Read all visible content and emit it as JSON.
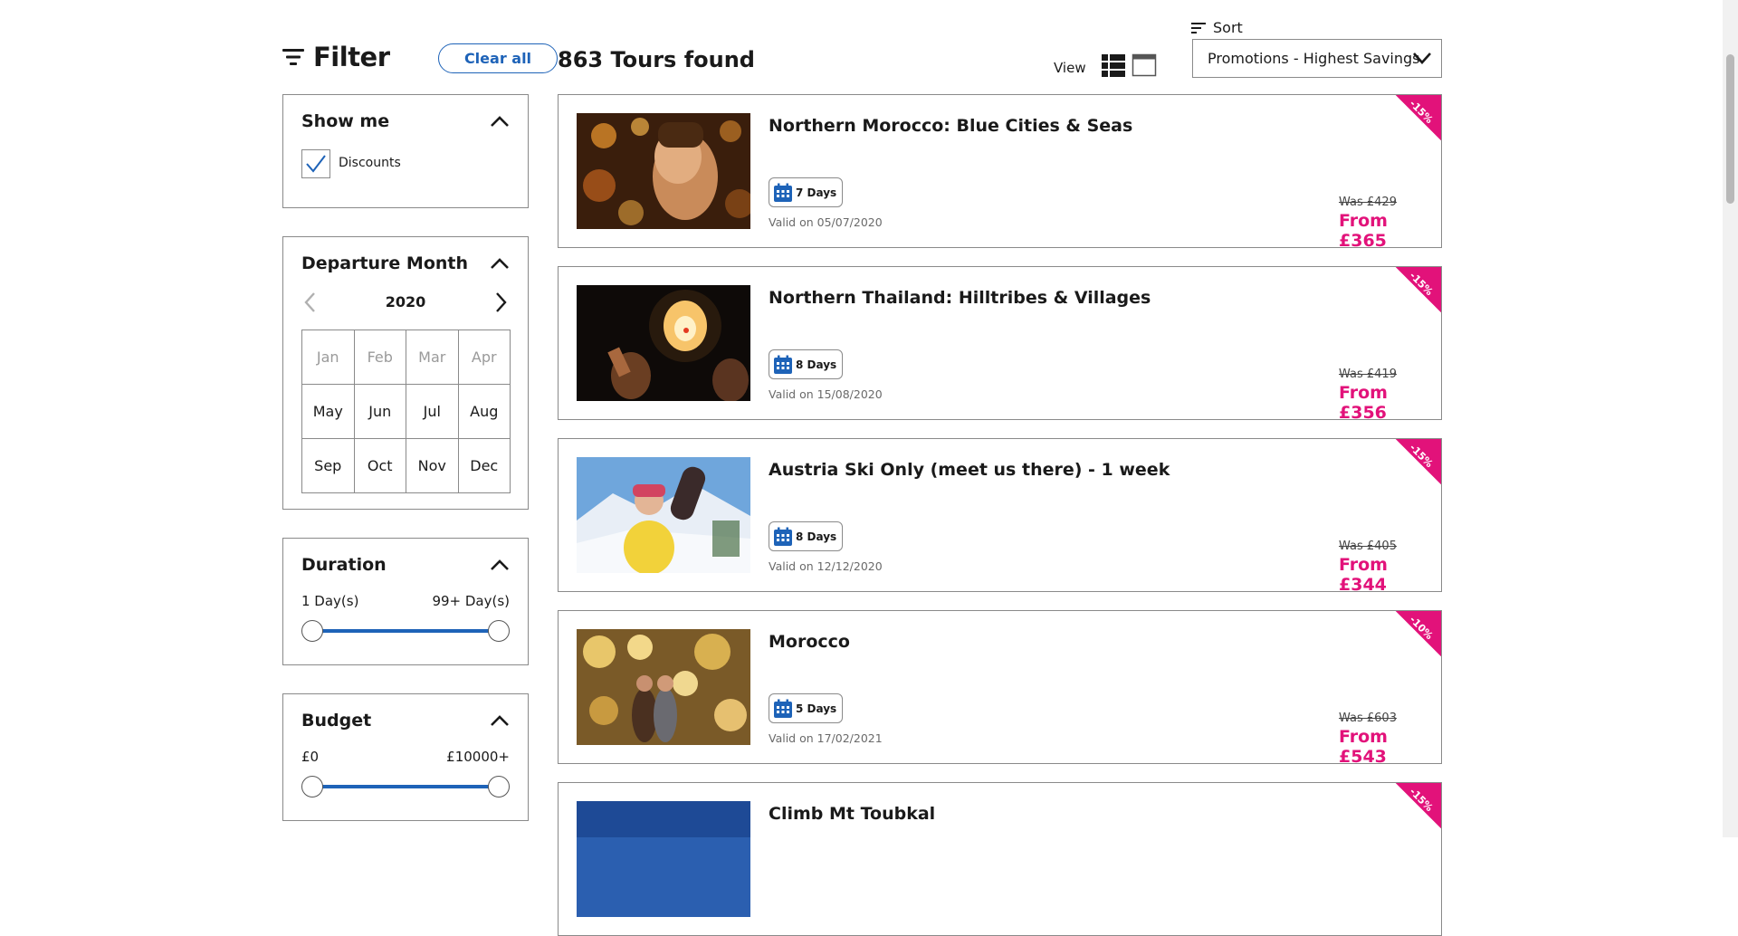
{
  "filter": {
    "title": "Filter",
    "clear_all": "Clear all",
    "show_me": {
      "title": "Show me",
      "option_label": "Discounts",
      "checked": true
    },
    "departure_month": {
      "title": "Departure Month",
      "year": "2020",
      "months": [
        {
          "label": "Jan",
          "enabled": false
        },
        {
          "label": "Feb",
          "enabled": false
        },
        {
          "label": "Mar",
          "enabled": false
        },
        {
          "label": "Apr",
          "enabled": false
        },
        {
          "label": "May",
          "enabled": true
        },
        {
          "label": "Jun",
          "enabled": true
        },
        {
          "label": "Jul",
          "enabled": true
        },
        {
          "label": "Aug",
          "enabled": true
        },
        {
          "label": "Sep",
          "enabled": true
        },
        {
          "label": "Oct",
          "enabled": true
        },
        {
          "label": "Nov",
          "enabled": true
        },
        {
          "label": "Dec",
          "enabled": true
        }
      ]
    },
    "duration": {
      "title": "Duration",
      "min_label": "1 Day(s)",
      "max_label": "99+ Day(s)"
    },
    "budget": {
      "title": "Budget",
      "min_label": "£0",
      "max_label": "£10000+"
    }
  },
  "results": {
    "count_label": "863 Tours found",
    "view_label": "View",
    "sort_label": "Sort",
    "sort_value": "Promotions - Highest Savings"
  },
  "colors": {
    "accent_blue": "#1e63b8",
    "price_pink": "#e2127a"
  },
  "tours": [
    {
      "title": "Northern Morocco: Blue Cities & Seas",
      "days": "7 Days",
      "valid": "Valid on 05/07/2020",
      "was": "Was £429",
      "from": "From £365",
      "discount": "-15%",
      "image": "lanterns-market"
    },
    {
      "title": "Northern Thailand: Hilltribes & Villages",
      "days": "8 Days",
      "valid": "Valid on 15/08/2020",
      "was": "Was £419",
      "from": "From £356",
      "discount": "-15%",
      "image": "sky-lantern-night"
    },
    {
      "title": "Austria Ski Only (meet us there) - 1 week",
      "days": "8 Days",
      "valid": "Valid on 12/12/2020",
      "was": "Was £405",
      "from": "From £344",
      "discount": "-15%",
      "image": "snowboarder-mountain"
    },
    {
      "title": "Morocco",
      "days": "5 Days",
      "valid": "Valid on 17/02/2021",
      "was": "Was £603",
      "from": "From £543",
      "discount": "-10%",
      "image": "lamp-shop"
    },
    {
      "title": "Climb Mt Toubkal",
      "discount": "-15%",
      "image": "blue-sky-mountain"
    }
  ]
}
